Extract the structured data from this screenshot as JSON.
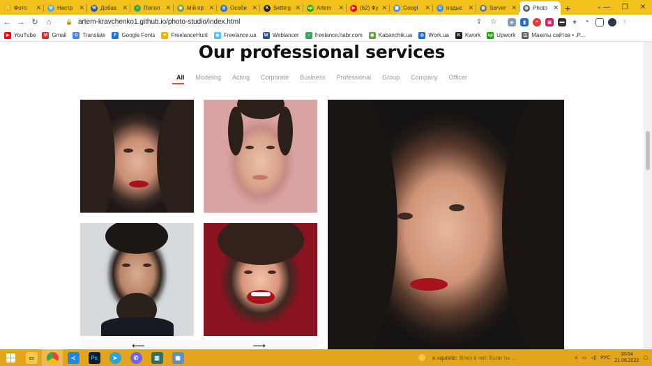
{
  "browser": {
    "tabs": [
      {
        "label": "Фото",
        "color": "#f4b400",
        "glyph": "G"
      },
      {
        "label": "Настр",
        "color": "#5aa9e6",
        "glyph": "⚙"
      },
      {
        "label": "Добав",
        "color": "#2a5699",
        "glyph": "W"
      },
      {
        "label": "Попол",
        "color": "#3aa657",
        "glyph": "▪"
      },
      {
        "label": "Мій пр",
        "color": "#6a9f3f",
        "glyph": "◉"
      },
      {
        "label": "Особи",
        "color": "#1f6fd1",
        "glyph": "◎"
      },
      {
        "label": "Setting",
        "color": "#222222",
        "glyph": "K"
      },
      {
        "label": "Artem",
        "color": "#14a800",
        "glyph": "up"
      },
      {
        "label": "(62) Фу",
        "color": "#ff0000",
        "glyph": "▶"
      },
      {
        "label": "Googl",
        "color": "#4285f4",
        "glyph": "▦"
      },
      {
        "label": "подыс",
        "color": "#4285f4",
        "glyph": "G"
      },
      {
        "label": "Server",
        "color": "#6c757d",
        "glyph": "◍"
      },
      {
        "label": "Photo",
        "color": "#5f6368",
        "glyph": "◍",
        "active": true
      }
    ],
    "new_tab": "+",
    "url": "artem-kravchenko1.github.io/photo-studio/index.html",
    "bookmarks": [
      {
        "label": "YouTube",
        "color": "#ff0000",
        "glyph": "▶"
      },
      {
        "label": "Gmail",
        "color": "#d93025",
        "glyph": "M"
      },
      {
        "label": "Translate",
        "color": "#4285f4",
        "glyph": "G"
      },
      {
        "label": "Google Fonts",
        "color": "#1a73e8",
        "glyph": "F"
      },
      {
        "label": "FreelanceHunt",
        "color": "#f4b400",
        "glyph": "✦"
      },
      {
        "label": "Freelance.ua",
        "color": "#4fc3f7",
        "glyph": "◉"
      },
      {
        "label": "Weblancer",
        "color": "#2a5699",
        "glyph": "W"
      },
      {
        "label": "freelance.habr.com",
        "color": "#3aa657",
        "glyph": "▪"
      },
      {
        "label": "Kabanchik.ua",
        "color": "#6a9f3f",
        "glyph": "◉"
      },
      {
        "label": "Work.ua",
        "color": "#1f6fd1",
        "glyph": "◎"
      },
      {
        "label": "Kwork",
        "color": "#222222",
        "glyph": "K"
      },
      {
        "label": "Upwork",
        "color": "#14a800",
        "glyph": "up"
      },
      {
        "label": "Макеты сайтов • .P...",
        "color": "#5f6368",
        "glyph": "◫"
      }
    ]
  },
  "page": {
    "title": "Our professional services",
    "filters": [
      "All",
      "Modeling",
      "Acting",
      "Corporate",
      "Business",
      "Professional",
      "Group",
      "Company",
      "Officer"
    ],
    "active_filter": "All",
    "prev_arrow": "⟵",
    "next_arrow": "⟶"
  },
  "taskbar": {
    "notification_user": "e.xquisite:",
    "notification_text": "Влез в чат. Если ты ...",
    "lang": "РУС",
    "time": "16:04",
    "date": "21.06.2022"
  }
}
